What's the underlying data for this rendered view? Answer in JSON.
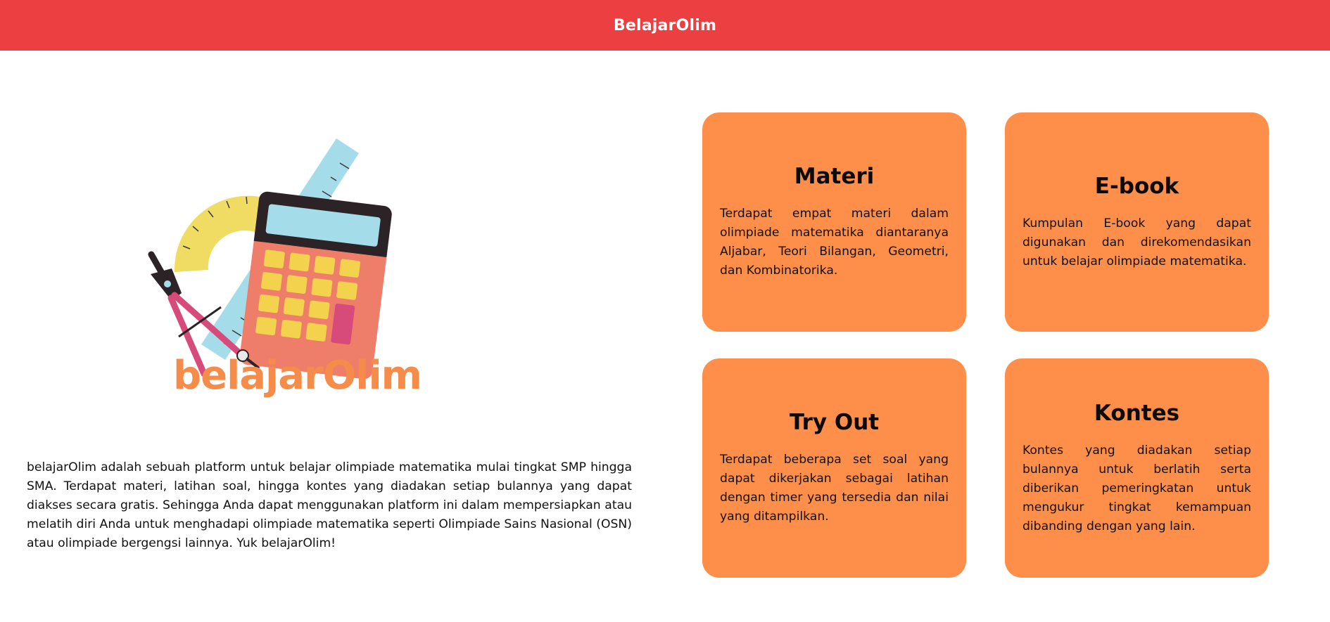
{
  "header": {
    "brand": "BelajarOlim"
  },
  "hero": {
    "logo_text": "belajarOlim",
    "description": "belajarOlim adalah sebuah platform untuk belajar olimpiade matematika mulai tingkat SMP hingga SMA. Terdapat materi, latihan soal, hingga kontes yang diadakan setiap bulannya yang dapat diakses secara gratis. Sehingga Anda dapat menggunakan platform ini dalam mempersiapkan atau melatih diri Anda untuk menghadapi olimpiade matematika seperti Olimpiade Sains Nasional (OSN) atau olimpiade bergengsi lainnya. Yuk belajarOlim!"
  },
  "cards": [
    {
      "title": "Materi",
      "text": "Terdapat empat materi dalam olimpiade matematika diantaranya Aljabar, Teori Bilangan, Geometri, dan Kombinatorika."
    },
    {
      "title": "E-book",
      "text": "Kumpulan E-book yang dapat digunakan dan direkomendasikan untuk belajar olimpiade matematika."
    },
    {
      "title": "Try Out",
      "text": "Terdapat beberapa set soal yang dapat dikerjakan sebagai latihan dengan timer yang tersedia dan nilai yang ditampilkan."
    },
    {
      "title": "Kontes",
      "text": "Kontes yang diadakan setiap bulannya untuk berlatih serta diberikan pemeringkatan untuk mengukur tingkat kemampuan dibanding dengan yang lain."
    }
  ],
  "colors": {
    "header_bg": "#ec3f42",
    "card_bg": "#fe8f4b",
    "logo_text": "#f68c49"
  },
  "icons": [
    "calculator-icon",
    "compass-icon",
    "protractor-icon",
    "ruler-icon"
  ]
}
